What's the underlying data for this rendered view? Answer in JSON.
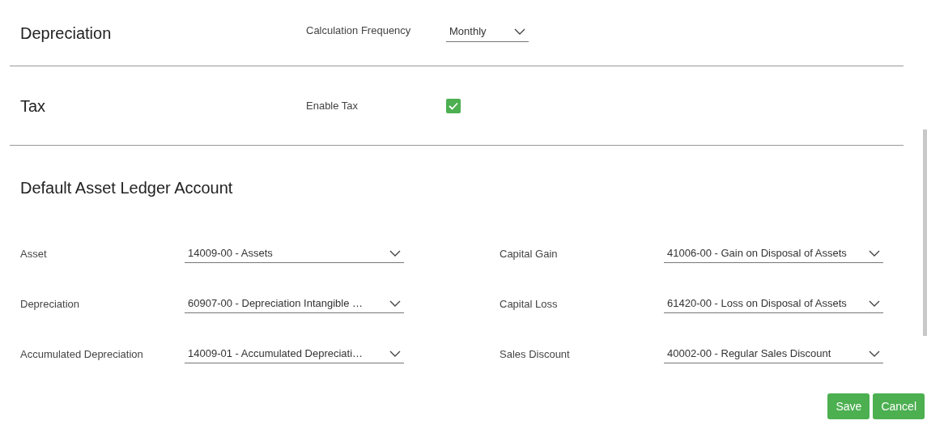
{
  "depreciation": {
    "title": "Depreciation",
    "field": {
      "label": "Calculation Frequency",
      "value": "Monthly"
    }
  },
  "tax": {
    "title": "Tax",
    "field": {
      "label": "Enable Tax",
      "checked": true
    }
  },
  "ledger": {
    "title": "Default Asset Ledger Account",
    "rows": [
      {
        "left": {
          "label": "Asset",
          "value": "14009-00 - Assets"
        },
        "right": {
          "label": "Capital Gain",
          "value": "41006-00 - Gain on Disposal of Assets"
        }
      },
      {
        "left": {
          "label": "Depreciation",
          "value": "60907-00 - Depreciation Intangible …"
        },
        "right": {
          "label": "Capital Loss",
          "value": "61420-00 - Loss on Disposal of Assets"
        }
      },
      {
        "left": {
          "label": "Accumulated Depreciation",
          "value": "14009-01 - Accumulated Depreciati…"
        },
        "right": {
          "label": "Sales Discount",
          "value": "40002-00 - Regular Sales Discount"
        }
      }
    ]
  },
  "buttons": [
    "Save",
    "Cancel"
  ]
}
